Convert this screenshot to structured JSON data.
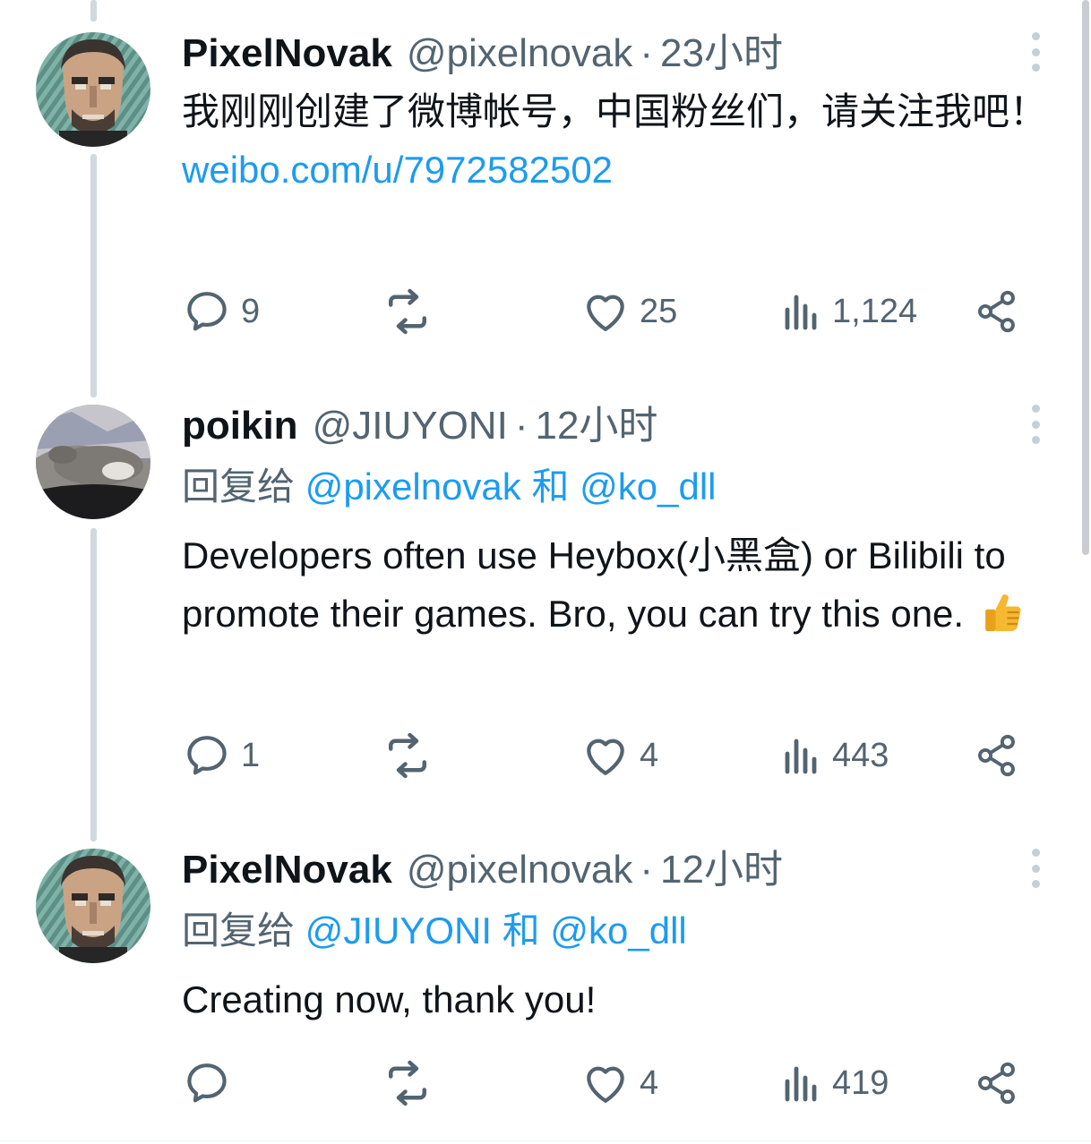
{
  "tweets": [
    {
      "name": "PixelNovak",
      "handle": "@pixelnovak",
      "dot": "·",
      "time": "23小时",
      "text": "我刚刚创建了微博帐号，中国粉丝们，请关注我吧！",
      "link": "weibo.com/u/7972582502",
      "reply": "9",
      "like": "25",
      "views": "1,124"
    },
    {
      "name": "poikin",
      "handle": "@JIUYONI",
      "dot": "·",
      "time": "12小时",
      "reply_prefix": "回复给",
      "reply_to_1": "@pixelnovak",
      "reply_and": "和",
      "reply_to_2": "@ko_dll",
      "text": "Developers often use Heybox(小黑盒) or Bilibili to promote their games. Bro, you can try this one.",
      "emoji": "thumbs-up",
      "reply": "1",
      "like": "4",
      "views": "443"
    },
    {
      "name": "PixelNovak",
      "handle": "@pixelnovak",
      "dot": "·",
      "time": "12小时",
      "reply_prefix": "回复给",
      "reply_to_1": "@JIUYONI",
      "reply_and": "和",
      "reply_to_2": "@ko_dll",
      "text": "Creating now, thank you!",
      "reply": "",
      "like": "4",
      "views": "419"
    }
  ],
  "icons": {
    "reply": "reply-icon",
    "retweet": "retweet-icon",
    "like": "heart-icon",
    "views": "views-icon",
    "share": "share-icon",
    "more": "more-vertical-icon"
  },
  "colors": {
    "link": "#1d9bf0",
    "secondary_text": "#536471",
    "thread_line": "#cfd9de"
  }
}
